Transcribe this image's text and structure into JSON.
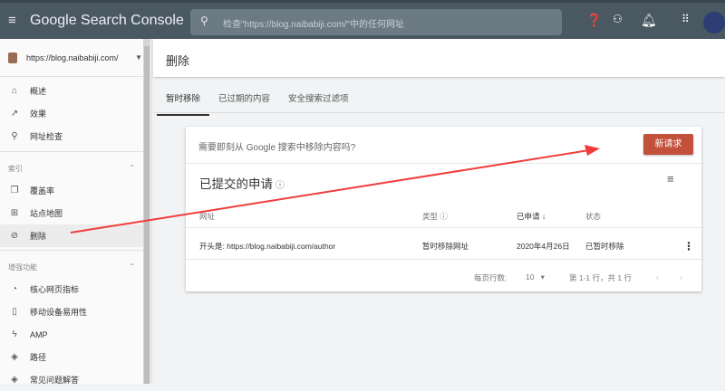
{
  "topbar": {
    "brand": "Google Search Console",
    "search_placeholder": "检查\"https://blog.naibabiji.com/\"中的任何网址"
  },
  "sidebar": {
    "property": "https://blog.naibabiji.com/",
    "items": [
      {
        "label": "概述",
        "icon": "home-icon"
      },
      {
        "label": "效果",
        "icon": "trending-icon"
      },
      {
        "label": "网址检查",
        "icon": "search-icon"
      }
    ],
    "index_section": "索引",
    "index_items": [
      {
        "label": "覆盖率",
        "icon": "copy-icon"
      },
      {
        "label": "站点地图",
        "icon": "sitemap-icon"
      },
      {
        "label": "删除",
        "icon": "eye-off-icon",
        "active": true
      }
    ],
    "enhance_section": "增强功能",
    "enhance_items": [
      {
        "label": "核心网页指标",
        "icon": "gauge-icon"
      },
      {
        "label": "移动设备易用性",
        "icon": "phone-icon"
      },
      {
        "label": "AMP",
        "icon": "bolt-icon"
      },
      {
        "label": "路径",
        "icon": "layers-icon"
      },
      {
        "label": "常见问题解答",
        "icon": "layers-icon"
      }
    ]
  },
  "main": {
    "title": "删除",
    "tabs": [
      "暂时移除",
      "已过期的内容",
      "安全搜索过滤项"
    ],
    "prompt": "需要即刻从 Google 搜索中移除内容吗?",
    "new_request": "新请求",
    "subtitle": "已提交的申请",
    "columns": [
      "网址",
      "类型",
      "已申请",
      "状态"
    ],
    "rows": [
      {
        "url": "开头是:  https://blog.naibabiji.com/author",
        "type": "暂时移除网址",
        "date": "2020年4月26日",
        "status": "已暂时移除"
      }
    ],
    "rows_per_page_label": "每页行数:",
    "rows_per_page": "10",
    "range": "第 1-1 行，共 1 行"
  },
  "colors": {
    "topbar": "#4a5862",
    "accent": "#c2503a",
    "annotation_arrow": "#f03c3c"
  }
}
